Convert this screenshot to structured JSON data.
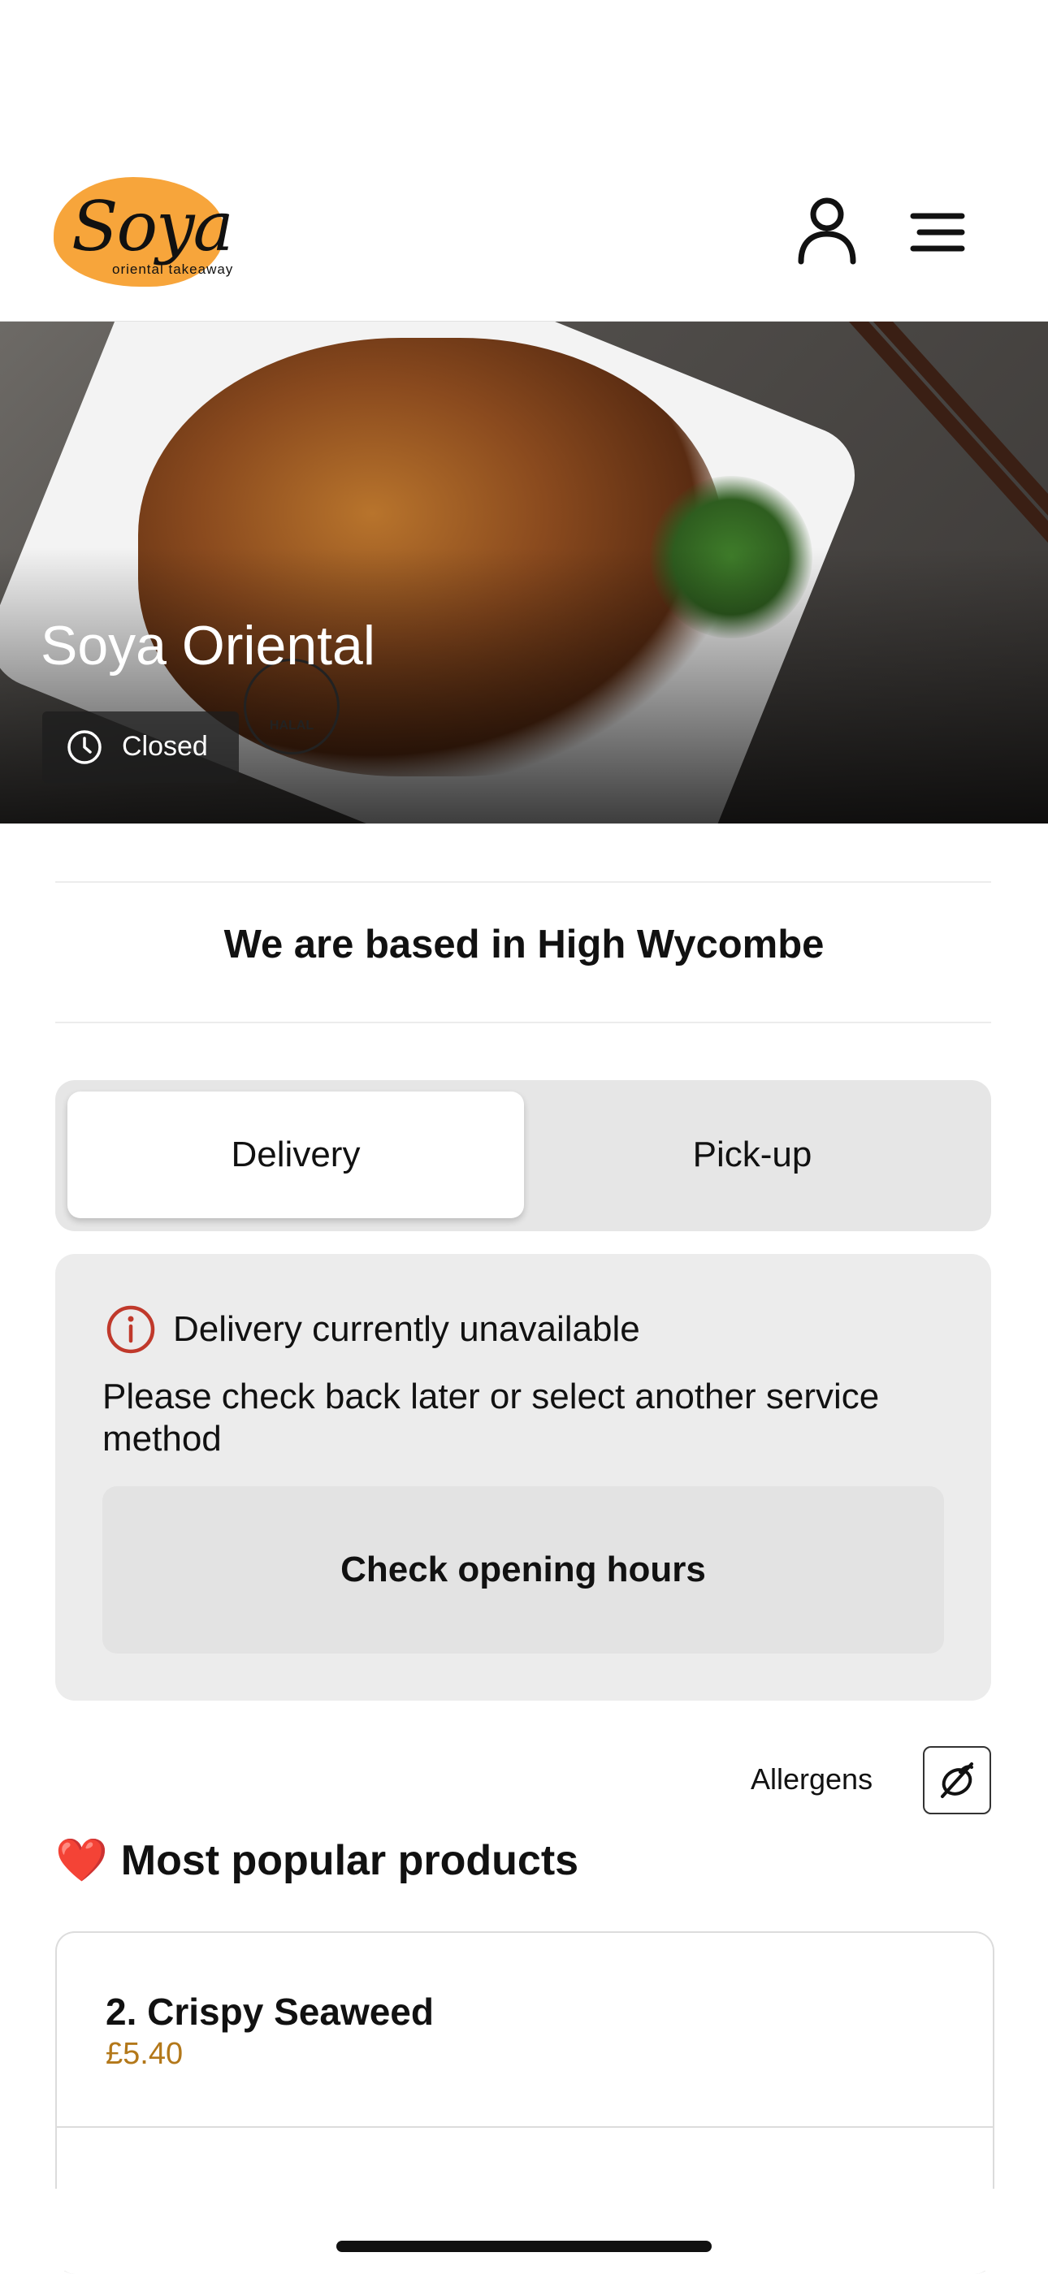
{
  "brand": {
    "logo_text": "Soya",
    "logo_subtitle": "oriental takeaway",
    "accent_color": "#f7a53b"
  },
  "header": {
    "account_icon": "user-icon",
    "menu_icon": "hamburger-menu-icon"
  },
  "hero": {
    "restaurant_name": "Soya Oriental",
    "status": "Closed",
    "status_icon": "clock-icon",
    "halal_badge": "HALAL"
  },
  "location": {
    "text": "We are based in High Wycombe"
  },
  "service_toggle": {
    "options": [
      "Delivery",
      "Pick-up"
    ],
    "selected": "Delivery"
  },
  "notice": {
    "icon": "info-icon",
    "icon_color": "#c0392b",
    "title": "Delivery currently unavailable",
    "body": "Please check back later or select another service method",
    "button_label": "Check opening hours"
  },
  "allergens": {
    "label": "Allergens",
    "icon": "allergen-icon"
  },
  "popular": {
    "title": "Most popular products",
    "emoji": "❤️",
    "items": [
      {
        "name": "2. Crispy Seaweed",
        "price": "£5.40"
      }
    ]
  }
}
